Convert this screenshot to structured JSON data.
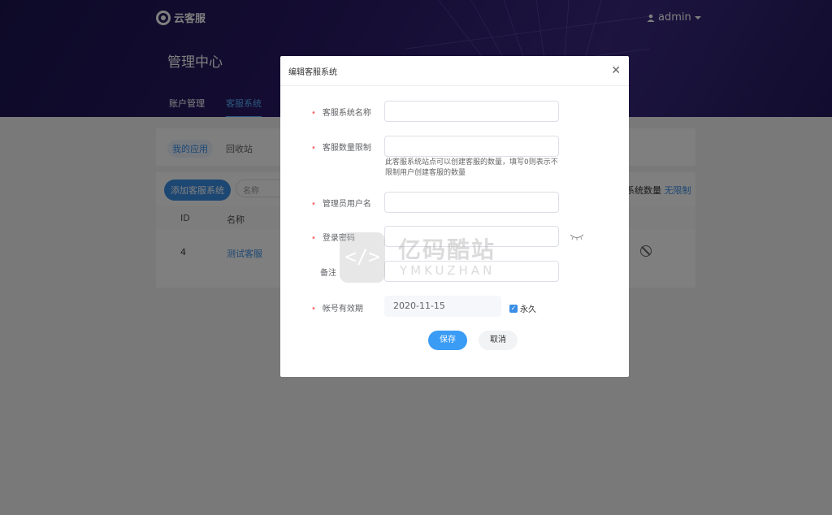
{
  "brand": {
    "name": "云客服"
  },
  "user": {
    "name": "admin"
  },
  "page_title": "管理中心",
  "nav_tabs": [
    {
      "label": "账户管理",
      "active": false
    },
    {
      "label": "客服系统",
      "active": true
    }
  ],
  "sub_tabs": [
    {
      "label": "我的应用",
      "active": true
    },
    {
      "label": "回收站",
      "active": false
    }
  ],
  "toolbar": {
    "add_label": "添加客服系统",
    "search_placeholder": "名称",
    "quota_label": "系统数量",
    "quota_value": "无限制"
  },
  "table": {
    "headers": [
      "ID",
      "名称"
    ],
    "rows": [
      {
        "id": "4",
        "name": "测试客服"
      }
    ]
  },
  "modal": {
    "title": "编辑客服系统",
    "fields": {
      "system_name": {
        "label": "客服系统名称",
        "value": ""
      },
      "cs_limit": {
        "label": "客服数量限制",
        "value": "",
        "help": "此客服系统站点可以创建客服的数量，填写0则表示不限制用户创建客服的数量"
      },
      "admin_username": {
        "label": "管理员用户名",
        "value": ""
      },
      "password": {
        "label": "登录密码",
        "value": ""
      },
      "remark": {
        "label": "备注",
        "value": ""
      },
      "expiry": {
        "label": "帐号有效期",
        "value": "2020-11-15",
        "forever_label": "永久",
        "forever_checked": true
      }
    },
    "save_label": "保存",
    "cancel_label": "取消"
  },
  "watermark": {
    "glyph": "</>",
    "name": "亿码酷站",
    "sub": "YMKUZHAN"
  },
  "colors": {
    "primary": "#3a8ee6",
    "required": "#f56c6c",
    "header_bg": "#2a1a66"
  }
}
